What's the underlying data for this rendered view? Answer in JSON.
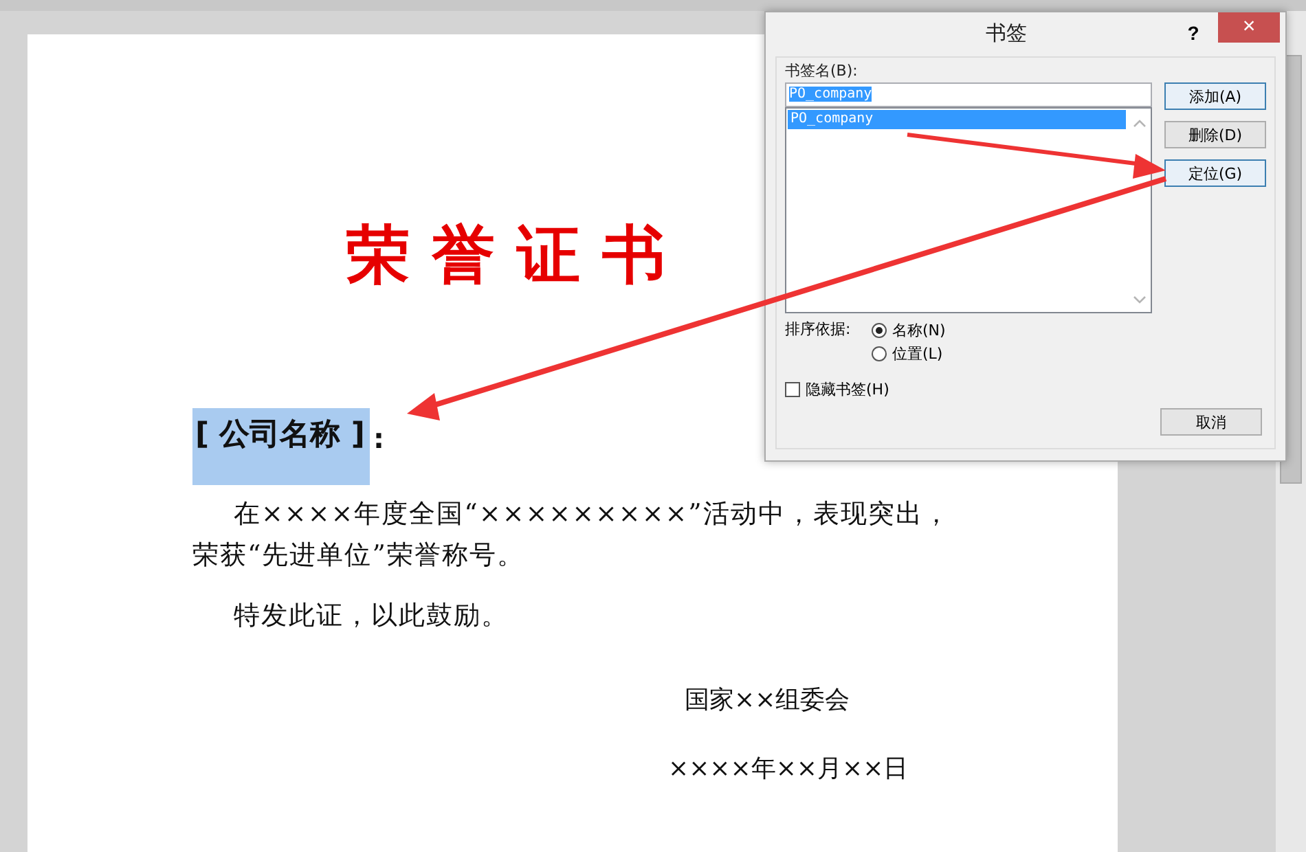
{
  "document": {
    "title": "荣 誉 证 书",
    "company": "[ 公司名称 ]",
    "colon": ":",
    "paragraphs": [
      "在××××年度全国“×××××××××”活动中，表现突出，荣获“先进单位”荣誉称号。",
      "特发此证，以此鼓励。"
    ],
    "issuer": "国家××组委会",
    "date": "××××年××月××日"
  },
  "dialog": {
    "title": "书签",
    "help": "?",
    "close": "×",
    "name_label": "书签名(B):",
    "name_value": "PO_company",
    "bookmarks": [
      {
        "label": "PO_company",
        "selected": true
      }
    ],
    "buttons": [
      {
        "label": "添加(A)",
        "focused": true
      },
      {
        "label": "删除(D)",
        "focused": false
      },
      {
        "label": "定位(G)",
        "focused": true
      }
    ],
    "sort_label": "排序依据:",
    "sort_options": [
      {
        "label": "名称(N)",
        "selected": true
      },
      {
        "label": "位置(L)",
        "selected": false
      }
    ],
    "hide_bookmarks": {
      "label": "隐藏书签(H)",
      "checked": false
    },
    "cancel": "取消"
  }
}
